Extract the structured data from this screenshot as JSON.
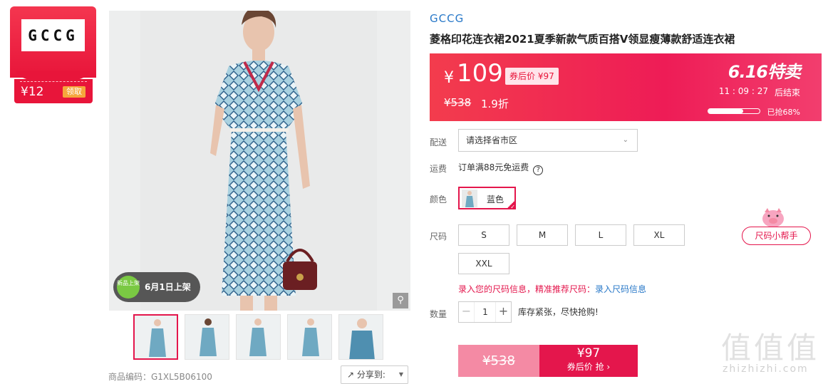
{
  "coupon": {
    "logo": "GCCG",
    "amount": "¥12",
    "get_label": "领取"
  },
  "gallery": {
    "badge_small": "新品上架",
    "badge_text": "6月1日上架",
    "zoom_icon": "magnifier-icon",
    "sku_label": "商品编码：G1XL5B06100",
    "share_label": "分享到:"
  },
  "product": {
    "brand": "GCCG",
    "title": "菱格印花连衣裙2021夏季新款气质百搭V领显瘦薄款舒适连衣裙"
  },
  "price": {
    "yen": "¥",
    "current": "109",
    "coupon_price": "券后价 ¥97",
    "original": "¥538",
    "discount": "1.9折",
    "promo": "6.16特卖",
    "countdown": "11 : 09 : 27",
    "ends_label": "后结束",
    "sold_percent": 0.68,
    "sold_label": "已抢68%"
  },
  "delivery": {
    "label": "配送",
    "placeholder": "请选择省市区"
  },
  "freight": {
    "label": "运费",
    "text": "订单满88元免运费"
  },
  "color": {
    "label": "颜色",
    "selected": "蓝色"
  },
  "size": {
    "label": "尺码",
    "options": [
      "S",
      "M",
      "L",
      "XL",
      "XXL"
    ],
    "helper": "尺码小帮手",
    "info_text": "录入您的尺码信息，精准推荐尺码：",
    "info_link": "录入尺码信息"
  },
  "quantity": {
    "label": "数量",
    "value": "1",
    "minus": "−",
    "plus": "+",
    "stock_msg": "库存紧张，尽快抢购!"
  },
  "buy": {
    "original": "¥538",
    "price": "¥97",
    "label": "券后价 抢 ›"
  },
  "watermark": {
    "glyphs": "值值值",
    "url": "zhizhizhi.com"
  },
  "colors": {
    "accent": "#e4164c",
    "link": "#2878c8",
    "price_bg": "#ee1c56"
  }
}
